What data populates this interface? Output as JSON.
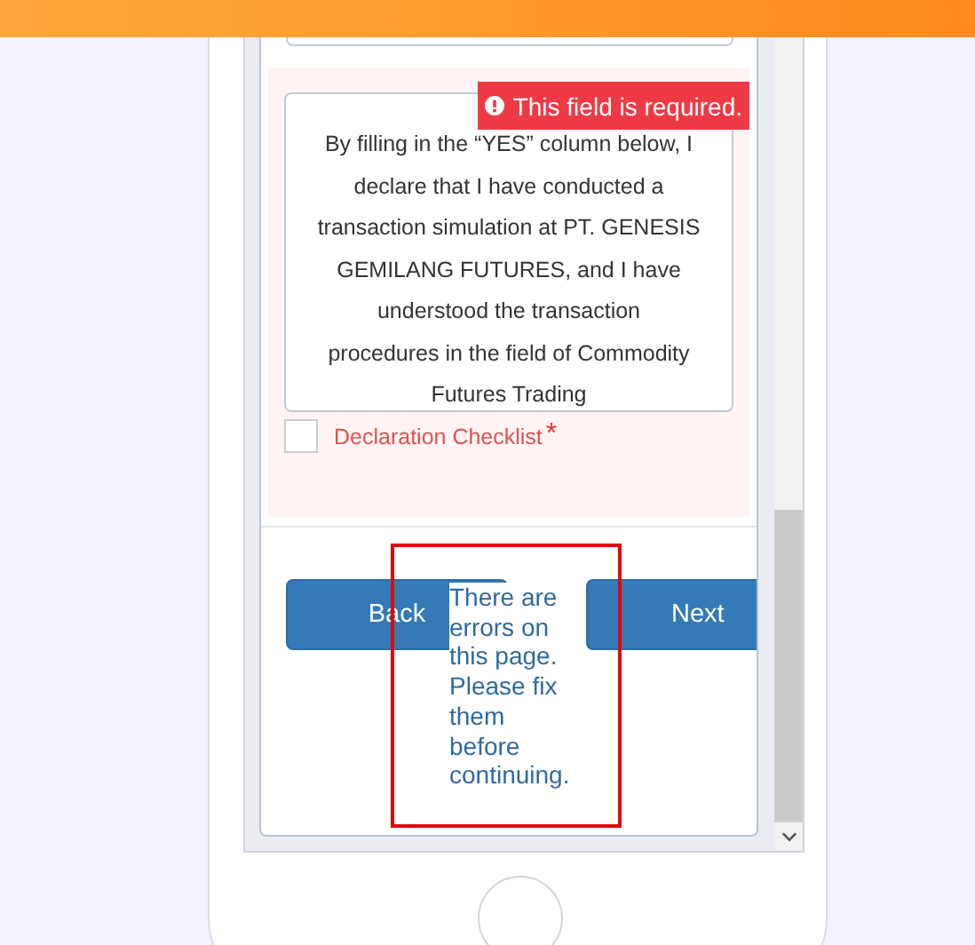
{
  "declaration": {
    "error": "This field is required.",
    "lines": [
      "By filling in the “YES” column below, I",
      "declare that I have conducted a",
      "transaction simulation at PT. GENESIS",
      "GEMILANG FUTURES, and I have",
      "understood the transaction",
      "procedures in the field of Commodity",
      "Futures Trading"
    ]
  },
  "checkbox": {
    "label": "Declaration Checklist",
    "required_mark": "*",
    "checked": false
  },
  "buttons": [
    {
      "label": "Back"
    },
    {
      "label": "Next"
    }
  ],
  "page_error": "There are errors on this page. Please fix them before continuing."
}
